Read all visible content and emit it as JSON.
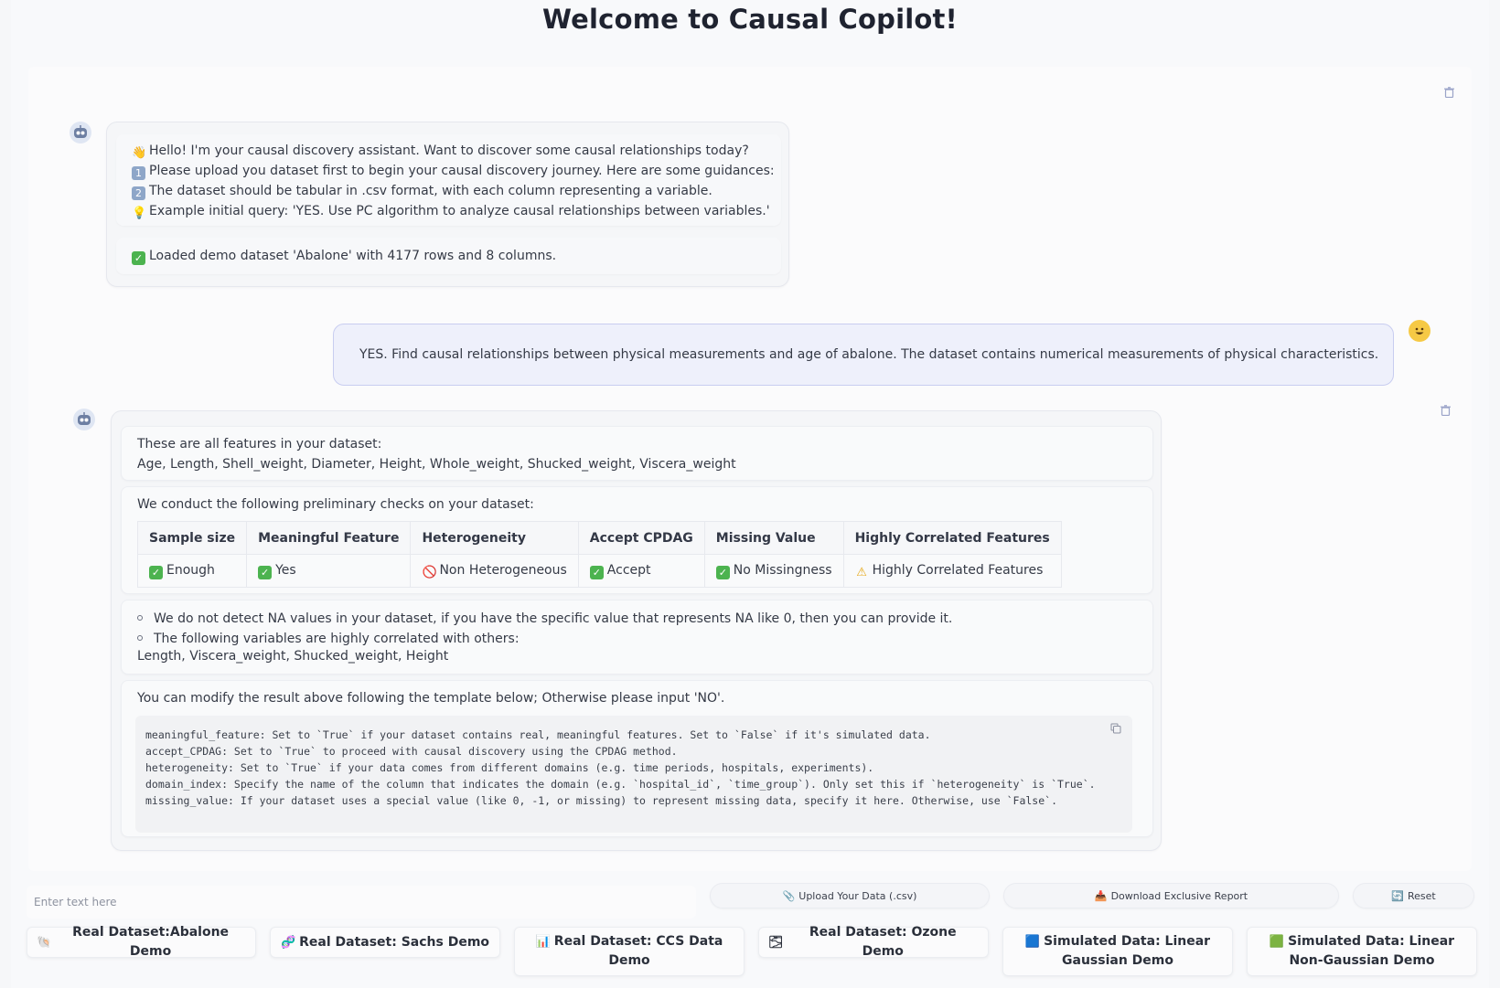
{
  "app": {
    "title": "Welcome to Causal Copilot!"
  },
  "messages": {
    "bot1": {
      "lines": [
        {
          "icon": "👋",
          "text": "Hello! I'm your causal discovery assistant. Want to discover some causal relationships today?"
        },
        {
          "icon": "1",
          "text": "Please upload you dataset first to begin your causal discovery journey. Here are some guidances:"
        },
        {
          "icon": "2",
          "text": "The dataset should be tabular in .csv format, with each column representing a variable."
        },
        {
          "icon": "💡",
          "text": "Example initial query: 'YES. Use PC algorithm to analyze causal relationships between variables.'"
        }
      ],
      "loaded": "Loaded demo dataset 'Abalone' with 4177 rows and 8 columns."
    },
    "user1": {
      "text": "YES. Find causal relationships between physical measurements and age of abalone. The dataset contains numerical measurements of physical characteristics."
    },
    "bot2": {
      "features_intro": "These are all features in your dataset:",
      "features_list": "Age, Length, Shell_weight, Diameter, Height, Whole_weight, Shucked_weight, Viscera_weight",
      "checks_intro": "We conduct the following preliminary checks on your dataset:",
      "checks_table": {
        "headers": [
          "Sample size",
          "Meaningful Feature",
          "Heterogeneity",
          "Accept CPDAG",
          "Missing Value",
          "Highly Correlated Features"
        ],
        "values": [
          {
            "icon": "✅",
            "text": "Enough"
          },
          {
            "icon": "✅",
            "text": "Yes"
          },
          {
            "icon": "🚫",
            "text": "Non Heterogeneous"
          },
          {
            "icon": "✅",
            "text": "Accept"
          },
          {
            "icon": "✅",
            "text": "No Missingness"
          },
          {
            "icon": "⚠️",
            "text": "Highly Correlated Features"
          }
        ]
      },
      "notes": [
        "We do not detect NA values in your dataset, if you have the specific value that represents NA like 0, then you can provide it.",
        "The following variables are highly correlated with others:"
      ],
      "correlated_list": "Length, Viscera_weight, Shucked_weight, Height",
      "template_intro": "You can modify the result above following the template below; Otherwise please input 'NO'.",
      "code_lines": [
        "meaningful_feature: Set to `True` if your dataset contains real, meaningful features. Set to `False` if it's simulated data.",
        "accept_CPDAG: Set to `True` to proceed with causal discovery using the CPDAG method.",
        "heterogeneity: Set to `True` if your data comes from different domains (e.g. time periods, hospitals, experiments).",
        "domain_index: Specify the name of the column that indicates the domain (e.g. `hospital_id`, `time_group`). Only set this if `heterogeneity` is `True`.",
        "missing_value: If your dataset uses a special value (like 0, -1, or missing) to represent missing data, specify it here. Otherwise, use `False`."
      ]
    }
  },
  "input": {
    "placeholder": "Enter text here"
  },
  "actions": {
    "upload": {
      "icon": "📎",
      "label": "Upload Your Data (.csv)"
    },
    "download": {
      "icon": "📥",
      "label": "Download Exclusive Report"
    },
    "reset": {
      "icon": "🔄",
      "label": "Reset"
    }
  },
  "demos": [
    {
      "icon": "🐚",
      "label": "Real Dataset:Abalone Demo"
    },
    {
      "icon": "🧬",
      "label": "Real Dataset: Sachs Demo"
    },
    {
      "icon": "📊",
      "label": "Real Dataset: CCS Data Demo"
    },
    {
      "icon": "🌫",
      "label": "Real Dataset: Ozone Demo"
    },
    {
      "icon": "🟦",
      "label": "Simulated Data: Linear Gaussian Demo"
    },
    {
      "icon": "🟩",
      "label": "Simulated Data: Linear Non-Gaussian Demo"
    }
  ]
}
